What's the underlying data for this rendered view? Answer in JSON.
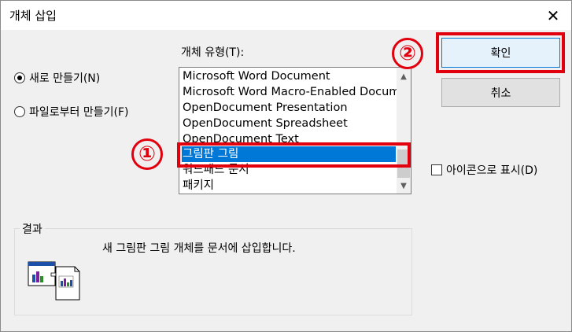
{
  "dialog": {
    "title": "개체 삽입",
    "close_glyph": "✕"
  },
  "options": {
    "create_new": "새로 만들기(N)",
    "create_from_file": "파일로부터 만들기(F)",
    "selected": "create_new"
  },
  "object_type": {
    "label": "개체 유형(T):",
    "items": [
      "Microsoft Word Document",
      "Microsoft Word Macro-Enabled Docum",
      "OpenDocument Presentation",
      "OpenDocument Spreadsheet",
      "OpenDocument Text",
      "그림판 그림",
      "워드패드 문서",
      "패키지"
    ],
    "selected_index": 5
  },
  "buttons": {
    "ok": "확인",
    "cancel": "취소"
  },
  "display_as_icon": {
    "label": "아이콘으로 표시(D)",
    "checked": false
  },
  "result": {
    "label": "결과",
    "text": "새 그림판 그림 개체를 문서에 삽입합니다."
  },
  "annotations": {
    "step1": "①",
    "step2": "②",
    "color": "#e2000f"
  },
  "colors": {
    "selection": "#0078d7",
    "dialog_bg": "#f0f0f0"
  }
}
